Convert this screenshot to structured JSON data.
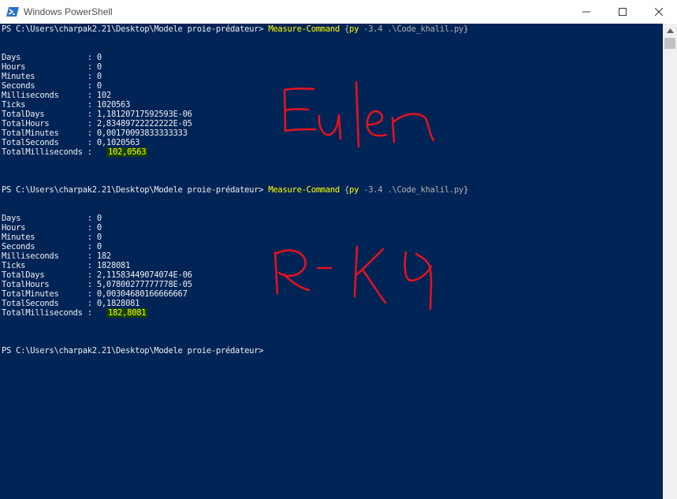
{
  "window": {
    "title": "Windows PowerShell"
  },
  "prompt": "PS C:\\Users\\charpak2.21\\Desktop\\Modele proie-prédateur> ",
  "command": {
    "cmdlet": "Measure-Command",
    "open": " {",
    "py": "py",
    "args": " -3.4 .\\Code_khalil.py",
    "close": "}"
  },
  "runs": [
    {
      "rows": [
        {
          "k": "Days              ",
          "v": "0"
        },
        {
          "k": "Hours             ",
          "v": "0"
        },
        {
          "k": "Minutes           ",
          "v": "0"
        },
        {
          "k": "Seconds           ",
          "v": "0"
        },
        {
          "k": "Milliseconds      ",
          "v": "102"
        },
        {
          "k": "Ticks             ",
          "v": "1020563"
        },
        {
          "k": "TotalDays         ",
          "v": "1,18120717592593E-06"
        },
        {
          "k": "TotalHours        ",
          "v": "2,83489722222222E-05"
        },
        {
          "k": "TotalMinutes      ",
          "v": "0,00170093833333333"
        },
        {
          "k": "TotalSeconds      ",
          "v": "0,1020563"
        }
      ],
      "total_key": "TotalMilliseconds ",
      "total_value": "102,0563",
      "annotation": "Euler"
    },
    {
      "rows": [
        {
          "k": "Days              ",
          "v": "0"
        },
        {
          "k": "Hours             ",
          "v": "0"
        },
        {
          "k": "Minutes           ",
          "v": "0"
        },
        {
          "k": "Seconds           ",
          "v": "0"
        },
        {
          "k": "Milliseconds      ",
          "v": "182"
        },
        {
          "k": "Ticks             ",
          "v": "1828081"
        },
        {
          "k": "TotalDays         ",
          "v": "2,11583449074074E-06"
        },
        {
          "k": "TotalHours        ",
          "v": "5,07800277777778E-05"
        },
        {
          "k": "TotalMinutes      ",
          "v": "0,00304680166666667"
        },
        {
          "k": "TotalSeconds      ",
          "v": "0,1828081"
        }
      ],
      "total_key": "TotalMilliseconds ",
      "total_value": "182,8081",
      "annotation": "R-K4"
    }
  ],
  "separator": ": ",
  "icons": [
    "powershell-icon",
    "minimize-icon",
    "maximize-icon",
    "close-icon",
    "scroll-up-arrow-icon"
  ],
  "colors": {
    "console_bg": "#012456",
    "cmdlet": "#ffff00",
    "ink": "#e8121b",
    "highlight": "#12400a"
  }
}
